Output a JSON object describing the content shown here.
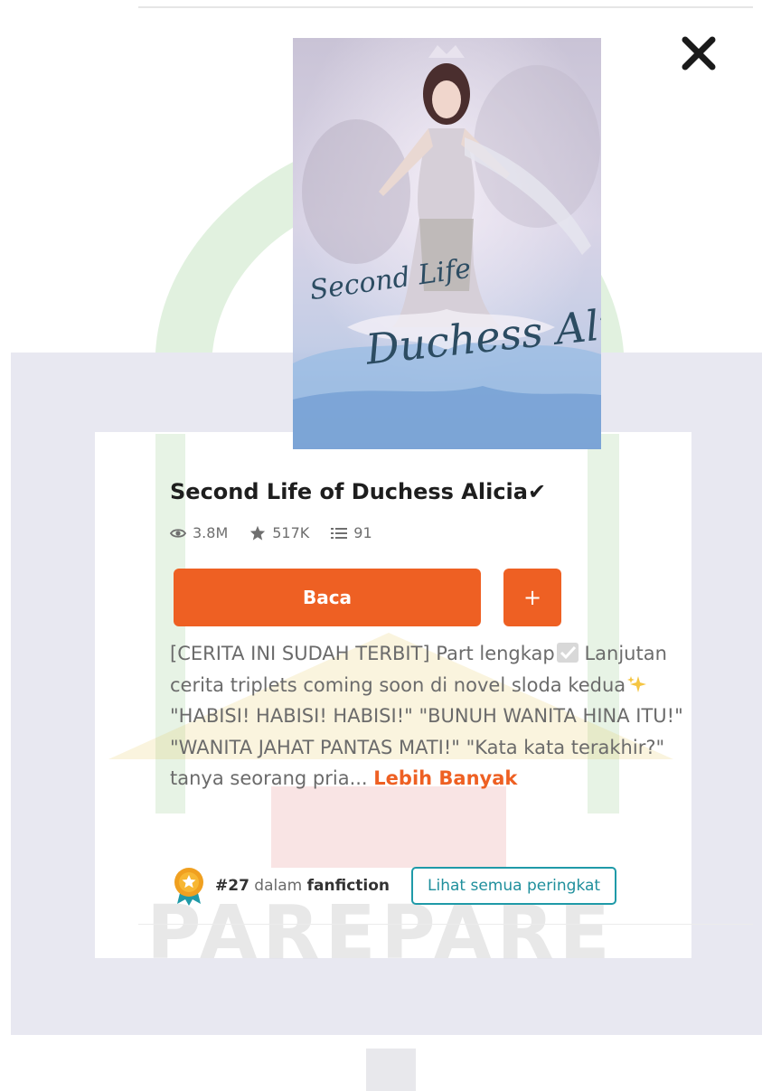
{
  "cover": {
    "title_line1": "Second Life",
    "title_line2": "Duchess Alicia"
  },
  "book": {
    "title": "Second Life of Duchess Alicia✔",
    "stats": {
      "reads": "3.8M",
      "votes": "517K",
      "parts": "91"
    }
  },
  "actions": {
    "read_label": "Baca",
    "add_label": "+"
  },
  "description": {
    "part1": "[CERITA INI SUDAH TERBIT] Part lengkap",
    "part2": " Lanjutan cerita triplets coming soon di novel sloda kedua",
    "part3": " \"HABISI! HABISI! HABISI!\" \"BUNUH WANITA HINA ITU!\" \"WANITA JAHAT PANTAS MATI!\" \"Kata kata terakhir?\" tanya seorang pria... ",
    "more_label": "Lebih Banyak"
  },
  "ranking": {
    "rank": "#27",
    "in_word": " dalam ",
    "category": "fanfiction",
    "all_rankings_label": "Lihat semua peringkat"
  },
  "watermark": {
    "text": "PAREPARE"
  },
  "colors": {
    "accent": "#ee6023",
    "teal": "#1f9aa8"
  },
  "icons": {
    "close": "close-icon",
    "reads": "eye-icon",
    "votes": "star-icon",
    "parts": "list-icon"
  }
}
